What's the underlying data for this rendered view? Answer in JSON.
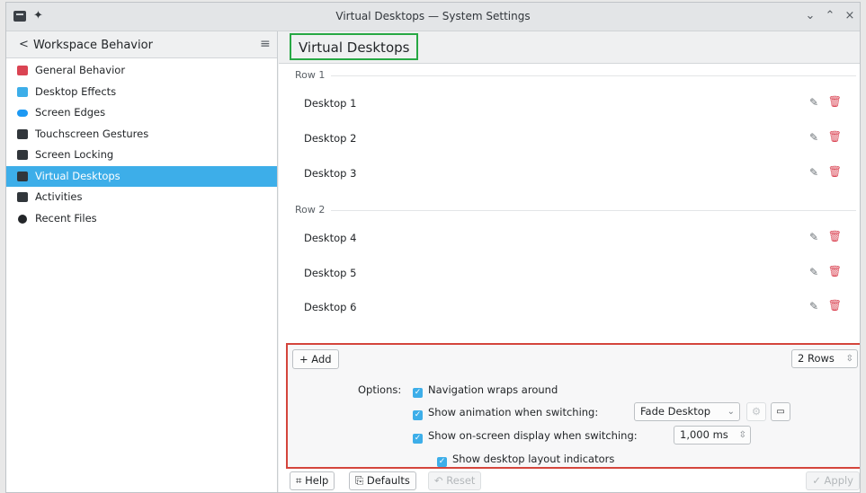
{
  "window": {
    "title": "Virtual Desktops — System Settings",
    "min_glyph": "⌄",
    "max_glyph": "⌃",
    "close_glyph": "×",
    "pin_glyph": "✦"
  },
  "sidebar": {
    "back_glyph": "<",
    "header_title": "Workspace Behavior",
    "menu_glyph": "≡",
    "items": [
      {
        "label": "General Behavior",
        "icon": "general-behavior-icon",
        "color": "#da4453"
      },
      {
        "label": "Desktop Effects",
        "icon": "desktop-effects-icon",
        "color": "#3daee9"
      },
      {
        "label": "Screen Edges",
        "icon": "screen-edges-icon",
        "color": "#1d99f3"
      },
      {
        "label": "Touchscreen Gestures",
        "icon": "touchscreen-gestures-icon",
        "color": "#31363b"
      },
      {
        "label": "Screen Locking",
        "icon": "screen-locking-icon",
        "color": "#31363b"
      },
      {
        "label": "Virtual Desktops",
        "icon": "virtual-desktops-icon",
        "color": "#31363b",
        "selected": true
      },
      {
        "label": "Activities",
        "icon": "activities-icon",
        "color": "#31363b"
      },
      {
        "label": "Recent Files",
        "icon": "recent-files-icon",
        "color": "#232629"
      }
    ]
  },
  "main": {
    "page_title": "Virtual Desktops",
    "rows": [
      {
        "label": "Row 1",
        "desktops": [
          "Desktop 1",
          "Desktop 2",
          "Desktop 3"
        ]
      },
      {
        "label": "Row 2",
        "desktops": [
          "Desktop 4",
          "Desktop 5",
          "Desktop 6"
        ]
      }
    ],
    "edit_glyph": "✎",
    "delete_glyph": "🗑"
  },
  "options": {
    "add_label": "+ Add",
    "rows_value": "2 Rows",
    "spin_glyph": "⇳",
    "options_label": "Options:",
    "nav_wraps": "Navigation wraps around",
    "show_animation": "Show animation when switching:",
    "animation_value": "Fade Desktop",
    "show_osd": "Show on-screen display when switching:",
    "osd_value": "1,000 ms",
    "show_layout_indicators": "Show desktop layout indicators"
  },
  "footer": {
    "help": "⌗ Help",
    "defaults": "⎘ Defaults",
    "reset": "↶ Reset",
    "apply": "✓ Apply"
  },
  "colors": {
    "accent": "#3daee9",
    "title_highlight": "#27a844",
    "options_highlight": "#d4453c"
  }
}
